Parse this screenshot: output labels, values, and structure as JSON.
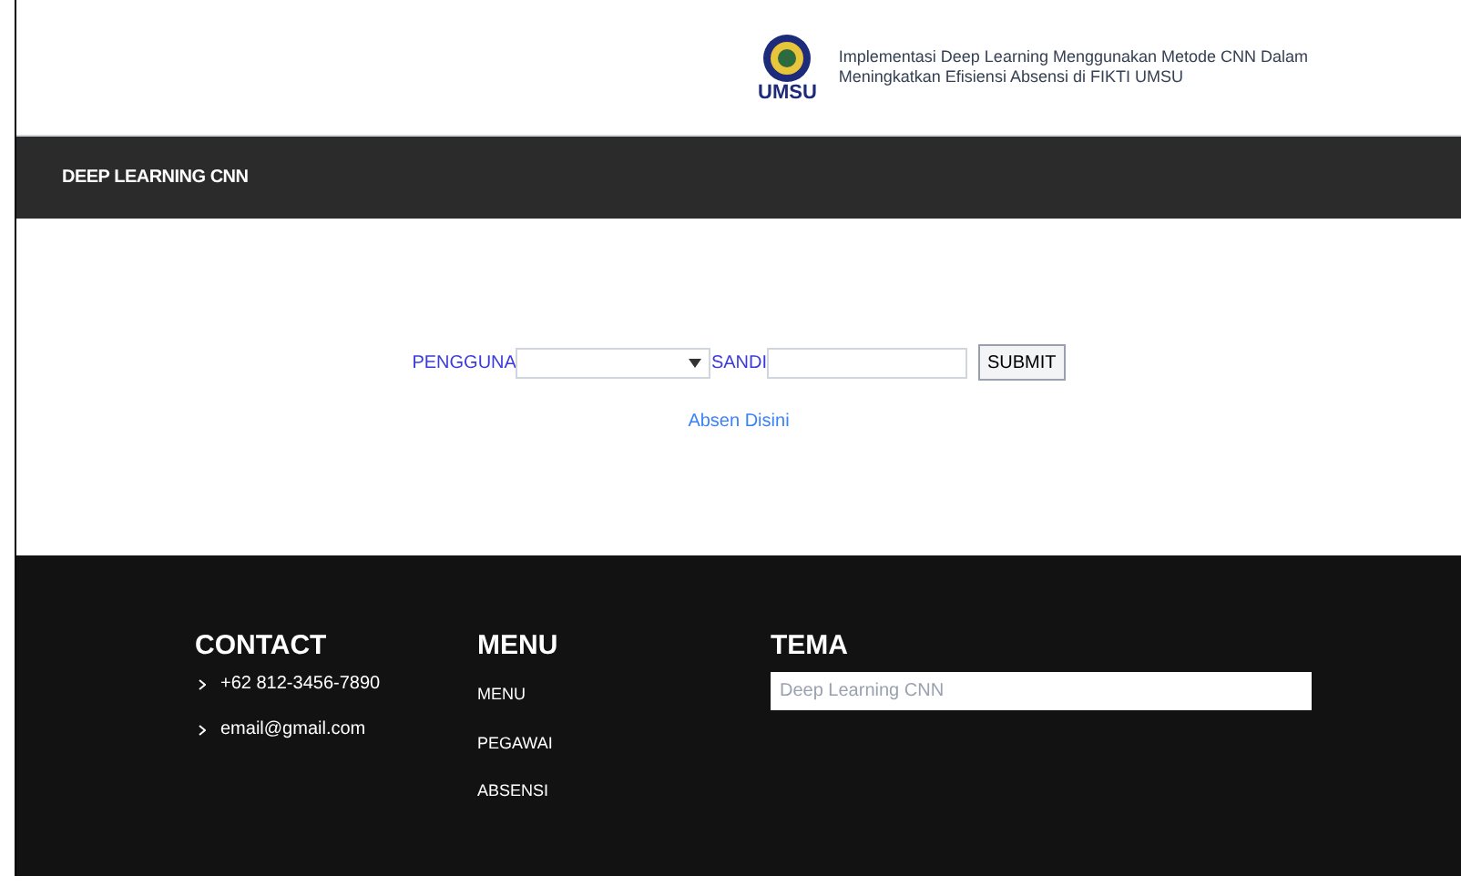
{
  "header": {
    "logo_text": "UMSU",
    "title_lines": [
      "Implementasi Deep Learning Menggunakan Metode CNN Dalam",
      "Meningkatkan Efisiensi Absensi di FIKTI UMSU"
    ]
  },
  "navbar": {
    "brand": "DEEP LEARNING CNN"
  },
  "login_form": {
    "user_label": "PENGGUNA",
    "password_label": "SANDI",
    "submit": "SUBMIT",
    "link": "Absen Disini"
  },
  "footer": {
    "contact": {
      "title": "CONTACT",
      "items": [
        "+62 812-3456-7890",
        "email@gmail.com"
      ]
    },
    "menu": {
      "title": "MENU",
      "items": [
        "MENU",
        "PEGAWAI",
        "ABSENSI"
      ]
    },
    "tema": {
      "title": "TEMA",
      "placeholder": "Deep Learning CNN"
    }
  }
}
